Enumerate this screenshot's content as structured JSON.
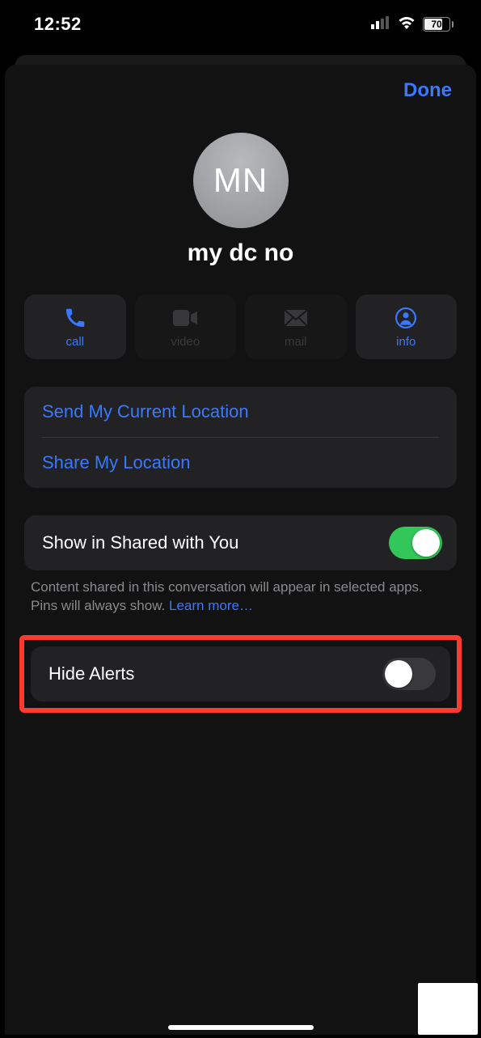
{
  "status": {
    "time": "12:52",
    "battery": "70"
  },
  "sheet": {
    "done": "Done",
    "avatar_initials": "MN",
    "contact_name": "my dc no",
    "actions": {
      "call": "call",
      "video": "video",
      "mail": "mail",
      "info": "info"
    },
    "location": {
      "send": "Send My Current Location",
      "share": "Share My Location"
    },
    "shared": {
      "label": "Show in Shared with You",
      "description": "Content shared in this conversation will appear in selected apps. Pins will always show. ",
      "learn_more": "Learn more…"
    },
    "hide_alerts": {
      "label": "Hide Alerts"
    }
  }
}
